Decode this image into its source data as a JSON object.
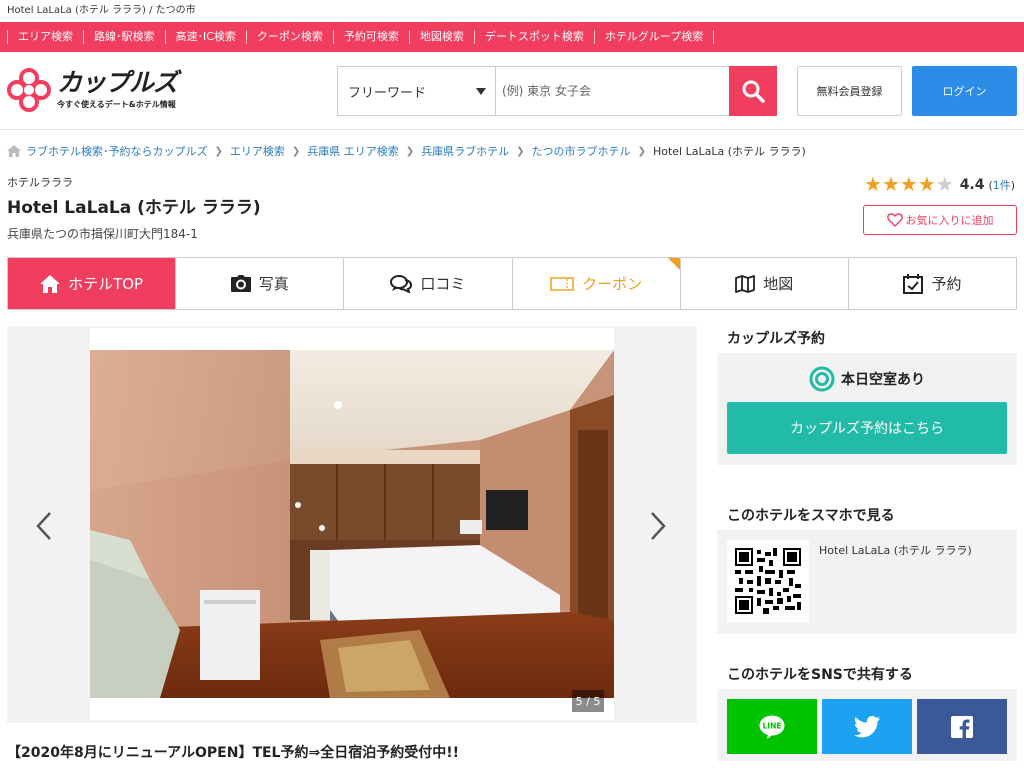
{
  "page_title": "Hotel LaLaLa (ホテル ラララ) / たつの市",
  "nav": [
    "エリア検索",
    "路線･駅検索",
    "高速･IC検索",
    "クーポン検索",
    "予約可検索",
    "地図検索",
    "デートスポット検索",
    "ホテルグループ検索"
  ],
  "logo": {
    "main": "カップルズ",
    "tagline": "今すぐ使えるデート&ホテル情報"
  },
  "search": {
    "select_value": "フリーワード",
    "placeholder": "(例) 東京 女子会"
  },
  "header_buttons": {
    "register": "無料会員登録",
    "login": "ログイン"
  },
  "breadcrumbs": [
    "ラブホテル検索･予約ならカップルズ",
    "エリア検索",
    "兵庫県 エリア検索",
    "兵庫県ラブホテル",
    "たつの市ラブホテル"
  ],
  "breadcrumb_current": "Hotel LaLaLa (ホテル ラララ)",
  "hotel": {
    "kana": "ホテルラララ",
    "name": "Hotel LaLaLa (ホテル ラララ)",
    "address": "兵庫県たつの市揖保川町大門184-1",
    "rating": 4.4,
    "rating_text": "4.4",
    "review_count_prefix": "(",
    "review_count": "1件",
    "review_count_suffix": ")",
    "favorite_label": "お気に入りに追加"
  },
  "tabs": [
    {
      "label": "ホテルTOP",
      "icon": "home-icon"
    },
    {
      "label": "写真",
      "icon": "camera-icon"
    },
    {
      "label": "口コミ",
      "icon": "chat-icon"
    },
    {
      "label": "クーポン",
      "icon": "ticket-icon"
    },
    {
      "label": "地図",
      "icon": "map-icon"
    },
    {
      "label": "予約",
      "icon": "calendar-icon"
    }
  ],
  "gallery": {
    "counter": "5 / 5"
  },
  "description_heading": "【2020年8月にリニューアルOPEN】TEL予約⇒全日宿泊予約受付中!!",
  "sidebar": {
    "booking_heading": "カップルズ予約",
    "vacancy": "本日空室あり",
    "booking_button": "カップルズ予約はこちら",
    "smartphone_heading": "このホテルをスマホで見る",
    "smartphone_hotel": "Hotel LaLaLa (ホテル ラララ)",
    "sns_heading": "このホテルをSNSで共有する"
  },
  "colors": {
    "brand": "#f13e5f",
    "accent_blue": "#2b8de8",
    "book_green": "#22bba8",
    "coupon_orange": "#f0a020",
    "line": "#00c300",
    "twitter": "#1da1f2",
    "facebook": "#3b5998"
  }
}
